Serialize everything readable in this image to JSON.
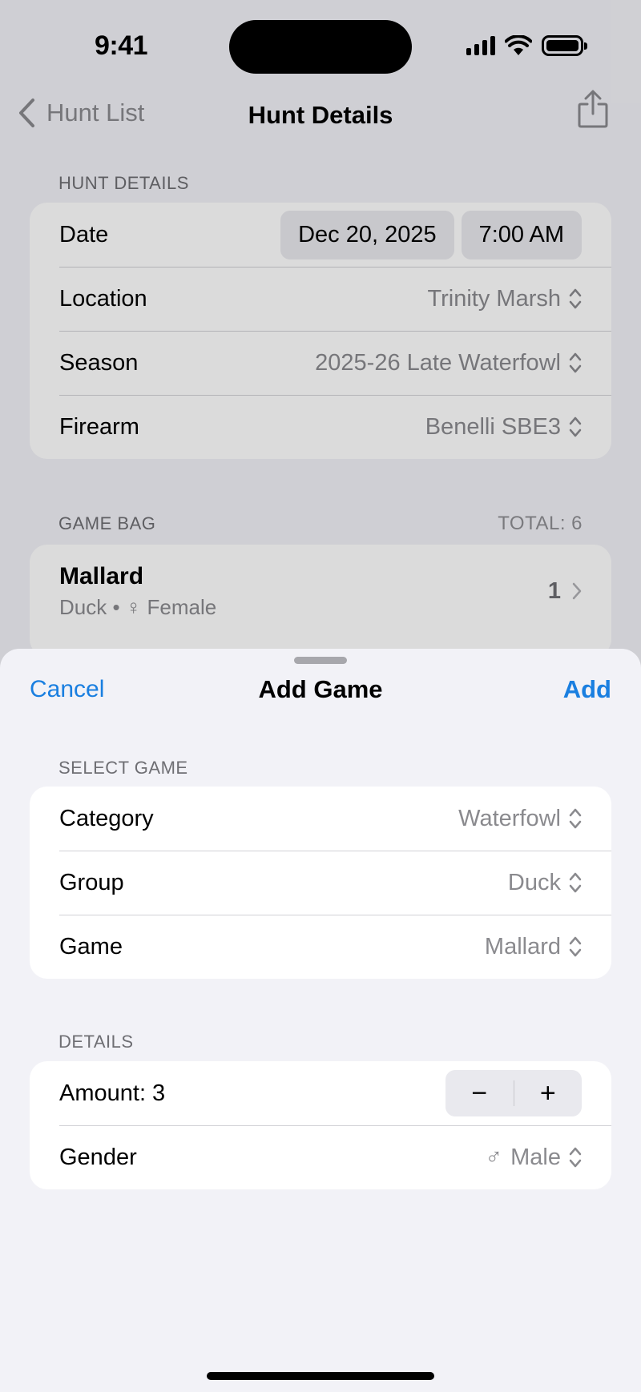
{
  "status_bar": {
    "time": "9:41"
  },
  "nav": {
    "back_label": "Hunt List",
    "title": "Hunt Details"
  },
  "hunt_details": {
    "header": "HUNT DETAILS",
    "date_label": "Date",
    "date_value": "Dec 20, 2025",
    "time_value": "7:00 AM",
    "rows": [
      {
        "label": "Location",
        "value": "Trinity Marsh"
      },
      {
        "label": "Season",
        "value": "2025-26 Late Waterfowl"
      },
      {
        "label": "Firearm",
        "value": "Benelli SBE3"
      }
    ]
  },
  "game_bag": {
    "header": "GAME BAG",
    "total": "TOTAL: 6",
    "items": [
      {
        "title": "Mallard",
        "group": "Duck",
        "gender": "Female",
        "gender_symbol": "♀",
        "count": "1"
      }
    ]
  },
  "sheet": {
    "cancel_label": "Cancel",
    "title": "Add Game",
    "add_label": "Add",
    "select_game": {
      "header": "SELECT GAME",
      "rows": [
        {
          "label": "Category",
          "value": "Waterfowl"
        },
        {
          "label": "Group",
          "value": "Duck"
        },
        {
          "label": "Game",
          "value": "Mallard"
        }
      ]
    },
    "details": {
      "header": "DETAILS",
      "amount_label": "Amount: 3",
      "stepper_minus": "−",
      "stepper_plus": "+",
      "gender_label": "Gender",
      "gender_symbol": "♂",
      "gender_value": "Male"
    }
  },
  "colors": {
    "accent": "#1a7fe0",
    "secondary_text": "#8a8a8e",
    "background": "#f2f2f7"
  }
}
